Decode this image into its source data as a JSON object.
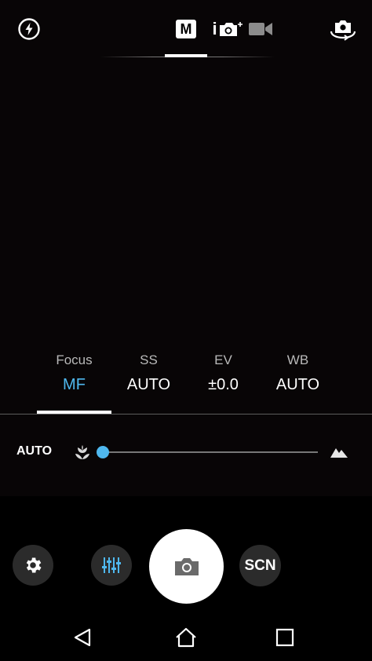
{
  "topbar": {
    "flash_icon": "flash-auto-icon",
    "mode_manual_label": "M",
    "mode_iauto_label": "i",
    "mode_video_icon": "video-camera-icon",
    "flip_icon": "switch-camera-icon"
  },
  "params": {
    "items": [
      {
        "label": "Focus",
        "value": "MF",
        "active": true
      },
      {
        "label": "SS",
        "value": "AUTO",
        "active": false
      },
      {
        "label": "EV",
        "value": "±0.0",
        "active": false
      },
      {
        "label": "WB",
        "value": "AUTO",
        "active": false
      }
    ]
  },
  "focus": {
    "auto_label": "AUTO",
    "near_icon": "macro-flower-icon",
    "far_icon": "mountain-infinity-icon",
    "slider_value": 0
  },
  "controls": {
    "settings_icon": "gear-icon",
    "adjust_icon": "sliders-icon",
    "shutter_icon": "camera-icon",
    "scene_label": "SCN"
  },
  "navbar": {
    "back_icon": "back-triangle-icon",
    "home_icon": "home-icon",
    "recents_icon": "recents-square-icon"
  },
  "colors": {
    "accent": "#4fb8ef",
    "background": "#000000",
    "button_bg": "#2b2b2b"
  }
}
